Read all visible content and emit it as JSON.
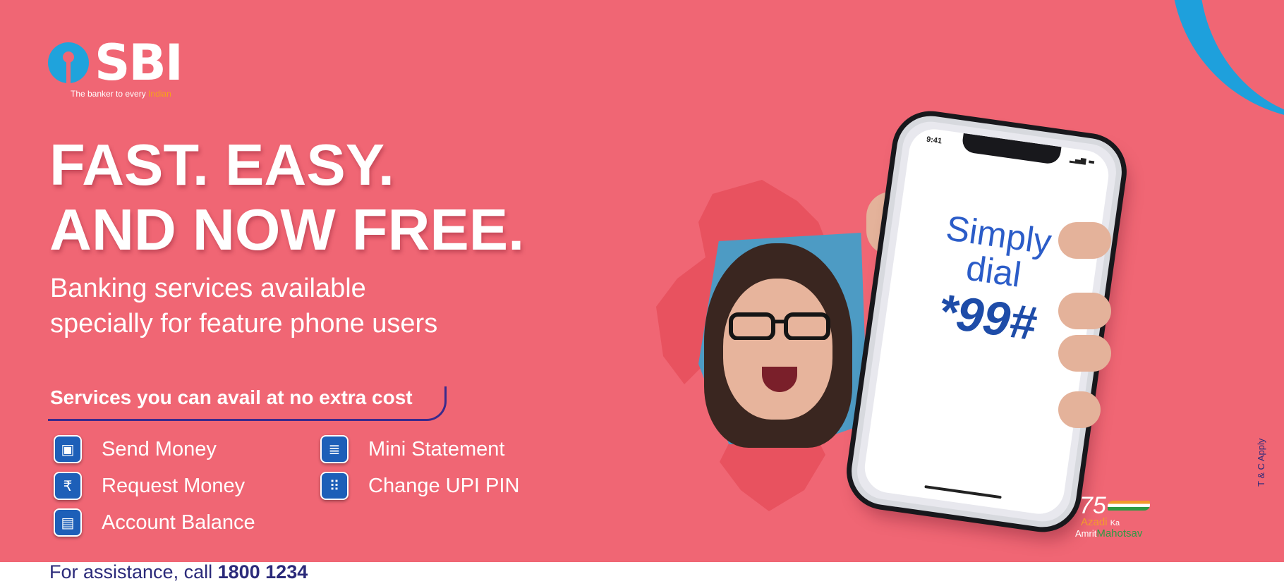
{
  "brand": {
    "name": "SBI",
    "tagline_prefix": "The banker to every ",
    "tagline_accent": "Indian",
    "colors": {
      "primary_blue": "#1fa3dc",
      "background": "#f06674",
      "navy": "#2b2a7a"
    }
  },
  "headline": {
    "line1": "FAST. EASY.",
    "line2": "AND NOW FREE."
  },
  "subhead": {
    "line1": "Banking services available",
    "line2": "specially for feature phone users"
  },
  "services": {
    "title": "Services you can avail at no extra cost",
    "items": [
      {
        "label": "Send Money",
        "icon": "wallet-icon"
      },
      {
        "label": "Request Money",
        "icon": "rupee-request-icon"
      },
      {
        "label": "Account Balance",
        "icon": "balance-icon"
      },
      {
        "label": "Mini Statement",
        "icon": "statement-icon"
      },
      {
        "label": "Change UPI PIN",
        "icon": "keypad-icon"
      }
    ]
  },
  "phone": {
    "time": "9:41",
    "line1": "Simply",
    "line2": "dial",
    "code": "*99#"
  },
  "amrit": {
    "number": "75",
    "w1": "Azadi",
    "w2": "Ka",
    "w3": "Amrit",
    "w4": "Mahotsav"
  },
  "disclaimer": "T & C Apply",
  "assistance": {
    "prefix": "For assistance, call ",
    "number": "1800 1234"
  }
}
